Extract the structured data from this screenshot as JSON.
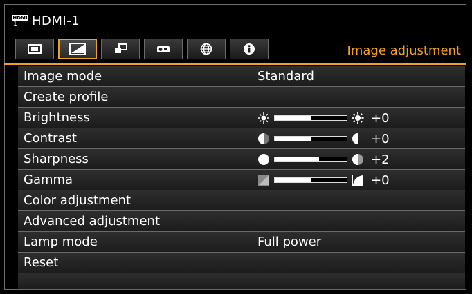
{
  "header": {
    "source_badge": "HDMI",
    "source_number": "1",
    "source_label": "HDMI-1",
    "menu_title": "Image adjustment",
    "accent_color": "#f0a020"
  },
  "tabs": [
    {
      "icon": "screen-icon",
      "active": false
    },
    {
      "icon": "image-adjust-icon",
      "active": true
    },
    {
      "icon": "installation-icon",
      "active": false
    },
    {
      "icon": "projector-icon",
      "active": false
    },
    {
      "icon": "network-icon",
      "active": false
    },
    {
      "icon": "info-icon",
      "active": false
    }
  ],
  "rows": {
    "image_mode": {
      "label": "Image mode",
      "value": "Standard"
    },
    "create_profile": {
      "label": "Create profile"
    },
    "brightness": {
      "label": "Brightness",
      "value": "+0",
      "level": 0.5
    },
    "contrast": {
      "label": "Contrast",
      "value": "+0",
      "level": 0.5
    },
    "sharpness": {
      "label": "Sharpness",
      "value": "+2",
      "level": 0.62
    },
    "gamma": {
      "label": "Gamma",
      "value": "+0",
      "level": 0.5
    },
    "color_adjustment": {
      "label": "Color adjustment"
    },
    "advanced_adjustment": {
      "label": "Advanced adjustment"
    },
    "lamp_mode": {
      "label": "Lamp mode",
      "value": "Full power"
    },
    "reset": {
      "label": "Reset"
    }
  }
}
